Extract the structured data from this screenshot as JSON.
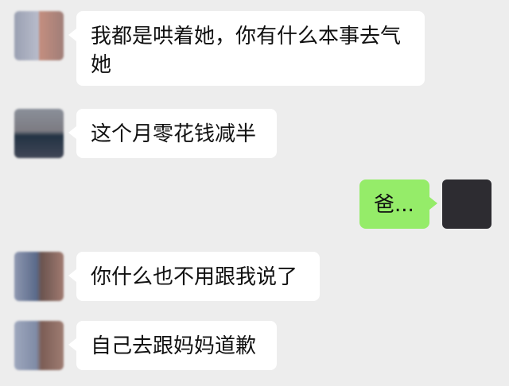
{
  "chat": {
    "messages": [
      {
        "side": "left",
        "text": "我都是哄着她，你有什么本事去气她"
      },
      {
        "side": "left",
        "text": "这个月零花钱减半"
      },
      {
        "side": "right",
        "text": "爸..."
      },
      {
        "side": "left",
        "text": "你什么也不用跟我说了"
      },
      {
        "side": "left",
        "text": "自己去跟妈妈道歉"
      }
    ]
  },
  "colors": {
    "background": "#ededed",
    "incoming_bubble": "#ffffff",
    "outgoing_bubble": "#95ec69",
    "text": "#111111"
  },
  "icons": {
    "contact_avatar": "contact-avatar-icon",
    "self_avatar": "self-avatar-icon"
  }
}
